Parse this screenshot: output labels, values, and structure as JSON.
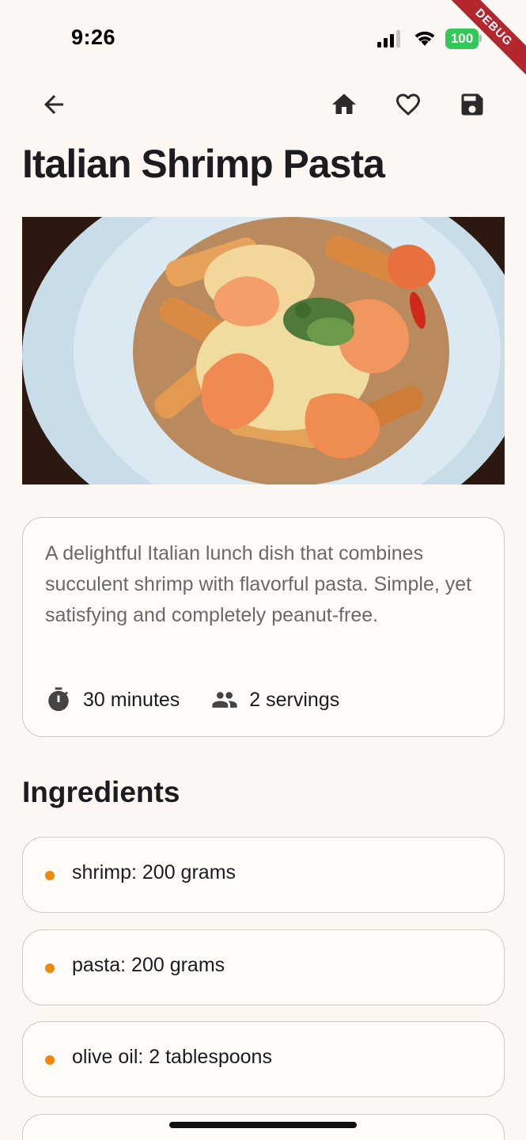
{
  "status_bar": {
    "time": "9:26",
    "battery": "100"
  },
  "debug_banner": "DEBUG",
  "recipe": {
    "title": "Italian Shrimp Pasta",
    "description": "A delightful Italian lunch dish that combines succulent shrimp with flavorful pasta. Simple, yet satisfying and completely peanut-free.",
    "time": "30 minutes",
    "servings": "2 servings"
  },
  "ingredients_heading": "Ingredients",
  "ingredients": [
    {
      "text": "shrimp: 200 grams"
    },
    {
      "text": "pasta: 200 grams"
    },
    {
      "text": "olive oil: 2 tablespoons"
    },
    {
      "text": ""
    }
  ],
  "icons": {
    "back": "arrow-back-icon",
    "home": "home-icon",
    "favorite": "heart-outline-icon",
    "save": "save-icon",
    "time": "timer-icon",
    "servings": "people-icon"
  },
  "colors": {
    "background": "#fdf7f3",
    "bullet": "#f0890b",
    "battery": "#34c759",
    "debug": "#b3262d"
  }
}
